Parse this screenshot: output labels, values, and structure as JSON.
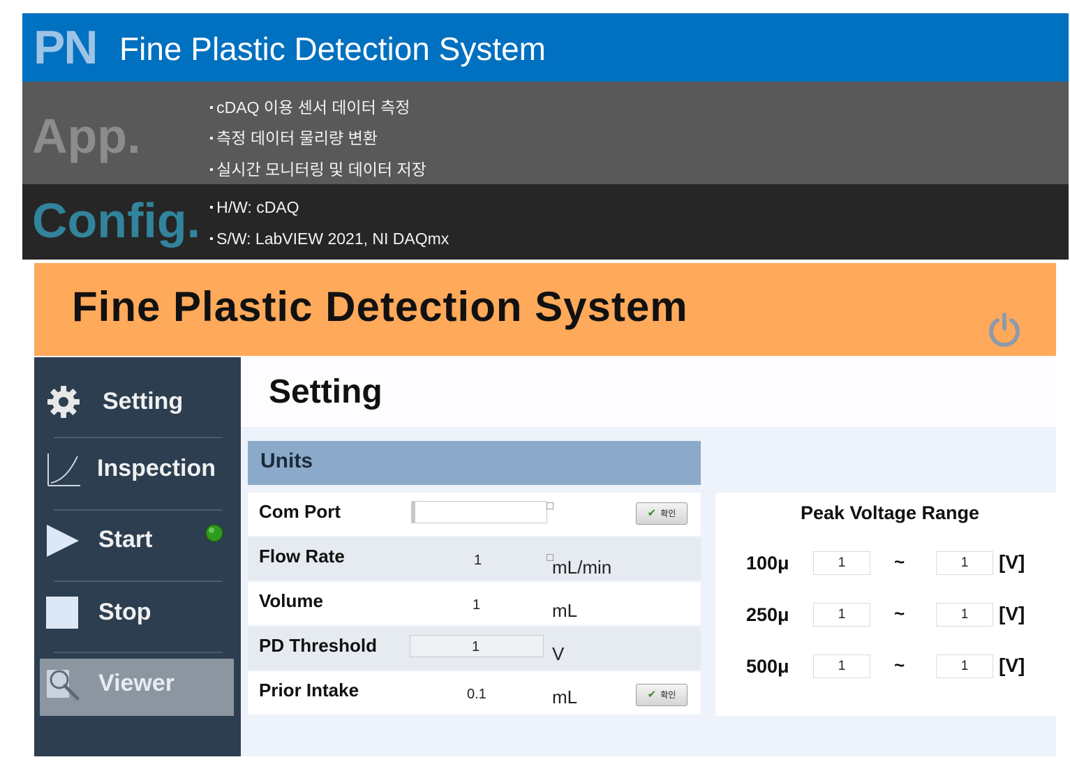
{
  "slide": {
    "pn_mark": "PN",
    "title": "Fine Plastic Detection System",
    "app_mark": "App.",
    "app_bullets": [
      "cDAQ 이용 센서 데이터 측정",
      "측정 데이터 물리량 변환",
      "실시간 모니터링 및 데이터 저장"
    ],
    "config_mark": "Config.",
    "config_bullets": [
      "H/W: cDAQ",
      "S/W: LabVIEW 2021, NI DAQmx"
    ]
  },
  "app": {
    "title": "Fine Plastic Detection  System",
    "power_icon": "power-icon",
    "nav": [
      {
        "label": "Setting",
        "icon": "gear-icon"
      },
      {
        "label": "Inspection",
        "icon": "chart-line-icon"
      },
      {
        "label": "Start",
        "icon": "play-icon"
      },
      {
        "label": "Stop",
        "icon": "stop-square-icon"
      },
      {
        "label": "Viewer",
        "icon": "magnifier-icon"
      }
    ],
    "status_color": "#2e9a1e",
    "page_title": "Setting",
    "units_header": "Units",
    "confirm_label": "확인",
    "rows": [
      {
        "label": "Com Port",
        "value": "",
        "unit": ""
      },
      {
        "label": "Flow Rate",
        "value": "1",
        "unit": "mL/min"
      },
      {
        "label": "Volume",
        "value": "1",
        "unit": "mL"
      },
      {
        "label": "PD Threshold",
        "value": "1",
        "unit": "V"
      },
      {
        "label": "Prior Intake",
        "value": "0.1",
        "unit": "mL"
      }
    ],
    "peak_voltage": {
      "title": "Peak Voltage Range",
      "tilde": "~",
      "unit": "[V]",
      "ranges": [
        {
          "label": "100μ",
          "min": "1",
          "max": "1"
        },
        {
          "label": "250μ",
          "min": "1",
          "max": "1"
        },
        {
          "label": "500μ",
          "min": "1",
          "max": "1"
        }
      ]
    }
  }
}
